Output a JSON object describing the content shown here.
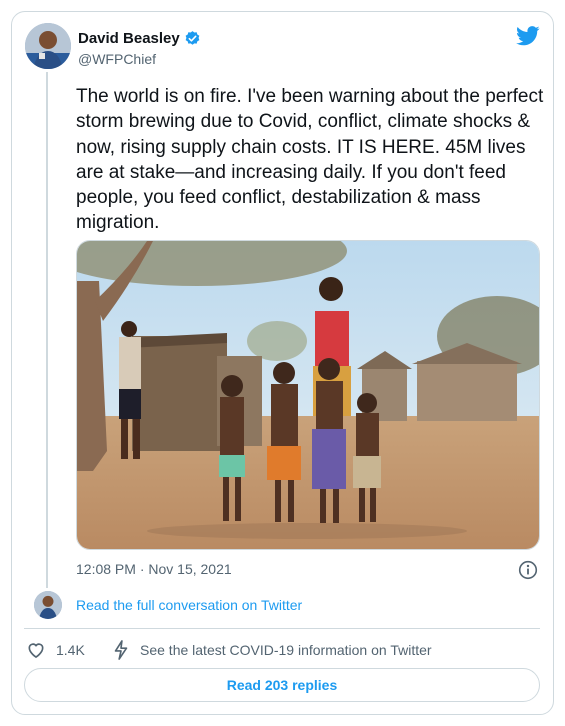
{
  "author": {
    "name": "David Beasley",
    "handle": "@WFPChief",
    "verified": true
  },
  "tweet": {
    "text": "The world is on fire. I've been warning about the perfect storm brewing due to Covid, conflict, climate shocks & now, rising supply chain costs. IT IS HERE. 45M lives are at stake—and increasing daily. If you don't feed people, you feed conflict, destabilization & mass migration.",
    "timestamp": "12:08 PM · Nov 15, 2021"
  },
  "thread": {
    "read_full_conversation": "Read the full conversation on Twitter"
  },
  "actions": {
    "like_count": "1.4K",
    "covid_info": "See the latest COVID-19 information on Twitter",
    "read_replies": "Read 203 replies"
  },
  "icons": {
    "brand": "twitter-bird-icon",
    "verified": "verified-badge-icon",
    "info": "info-icon",
    "like": "heart-icon",
    "covid": "lightning-icon"
  },
  "colors": {
    "accent": "#1d9bf0",
    "text": "#0f1419",
    "secondary": "#536471",
    "border": "#cfd9de"
  }
}
